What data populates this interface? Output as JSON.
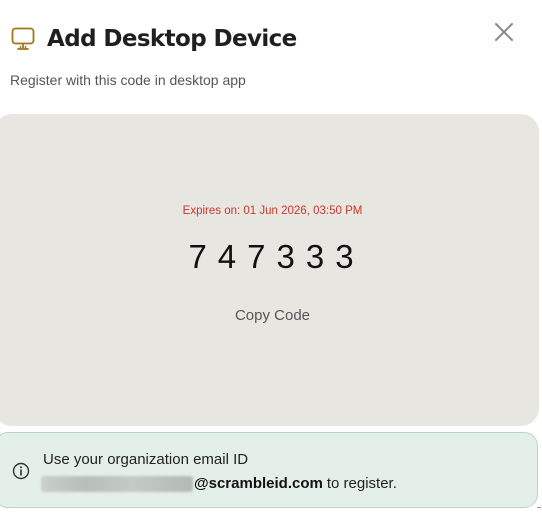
{
  "dialog": {
    "title": "Add Desktop Device",
    "subtitle": "Register with this code in desktop app",
    "header_icon": "desktop-monitor-icon",
    "close_icon": "close-icon"
  },
  "code_card": {
    "expires_label": "Expires on: 01 Jun 2026, 03:50 PM",
    "code": "747333",
    "copy_label": "Copy Code"
  },
  "info": {
    "icon": "info-icon",
    "line1": "Use your organization email ID",
    "email_domain": "@scrambleid.com",
    "line2_suffix": "to register."
  },
  "colors": {
    "accent_gold": "#a0761a",
    "expires_red": "#c8372d",
    "card_bg": "#e8e6e1",
    "info_bg": "#e5efea",
    "info_border": "#b9d5c8"
  }
}
